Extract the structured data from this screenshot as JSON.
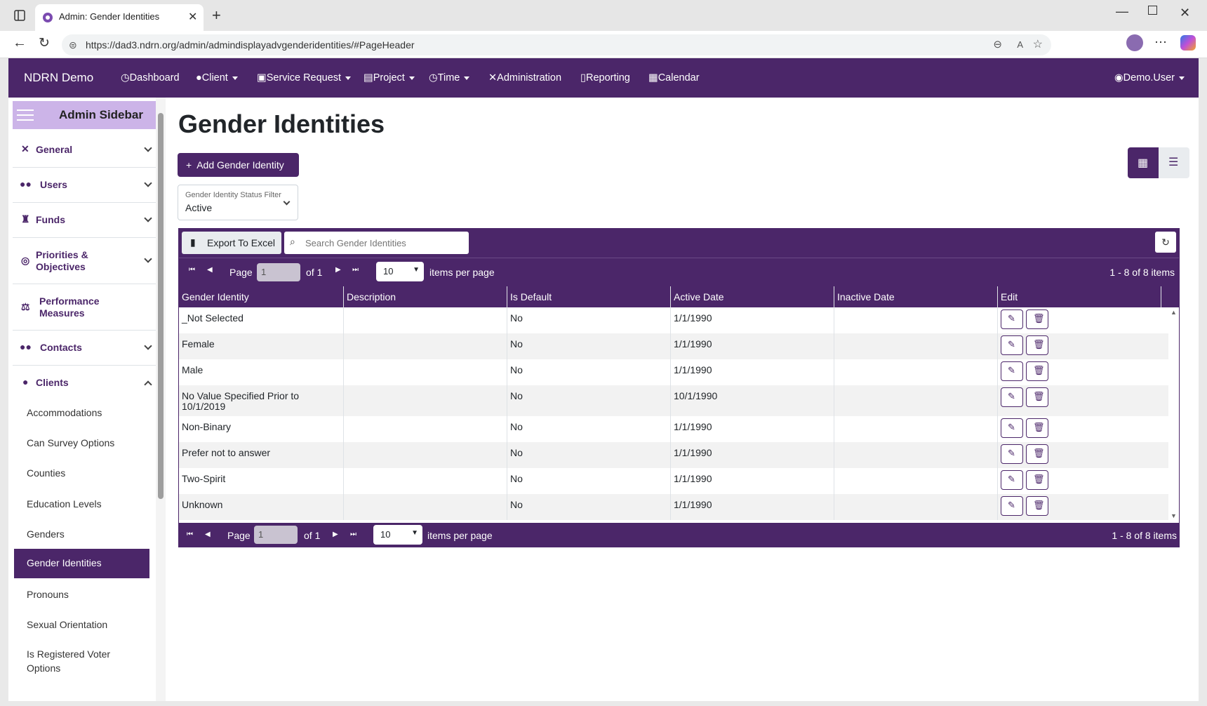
{
  "browser": {
    "tab_title": "Admin: Gender Identities",
    "url": "https://dad3.ndrn.org/admin/admindisplayadvgenderidentities/#PageHeader"
  },
  "nav": {
    "brand": "NDRN Demo",
    "items": [
      "Dashboard",
      "Client",
      "Service Request",
      "Project",
      "Time",
      "Administration",
      "Reporting",
      "Calendar"
    ],
    "user": "Demo.User"
  },
  "sidebar": {
    "title": "Admin Sidebar",
    "sections": [
      "General",
      "Users",
      "Funds",
      "Priorities & Objectives",
      "Performance Measures",
      "Contacts",
      "Clients"
    ],
    "client_items": [
      "Accommodations",
      "Can Survey Options",
      "Counties",
      "Education Levels",
      "Genders",
      "Gender Identities",
      "Pronouns",
      "Sexual Orientation",
      "Is Registered Voter Options"
    ],
    "active_item": "Gender Identities"
  },
  "page": {
    "title": "Gender Identities",
    "add_button": "Add Gender Identity",
    "filter_label": "Gender Identity Status Filter",
    "filter_value": "Active",
    "export_button": "Export To Excel",
    "search_placeholder": "Search Gender Identities"
  },
  "pager": {
    "page_label": "Page",
    "page_value": "1",
    "of_label": "of 1",
    "per_page": "10",
    "per_page_label": "items per page",
    "summary": "1 - 8 of 8 items"
  },
  "grid": {
    "columns": [
      "Gender Identity",
      "Description",
      "Is Default",
      "Active Date",
      "Inactive Date",
      "Edit"
    ],
    "rows": [
      [
        "_Not Selected",
        "",
        "No",
        "1/1/1990",
        ""
      ],
      [
        "Female",
        "",
        "No",
        "1/1/1990",
        ""
      ],
      [
        "Male",
        "",
        "No",
        "1/1/1990",
        ""
      ],
      [
        "No Value Specified Prior to 10/1/2019",
        "",
        "No",
        "10/1/1990",
        ""
      ],
      [
        "Non-Binary",
        "",
        "No",
        "1/1/1990",
        ""
      ],
      [
        "Prefer not to answer",
        "",
        "No",
        "1/1/1990",
        ""
      ],
      [
        "Two-Spirit",
        "",
        "No",
        "1/1/1990",
        ""
      ],
      [
        "Unknown",
        "",
        "No",
        "1/1/1990",
        ""
      ]
    ]
  },
  "colors": {
    "primary": "#4b2669",
    "sidebar_header": "#ccb4e8"
  }
}
